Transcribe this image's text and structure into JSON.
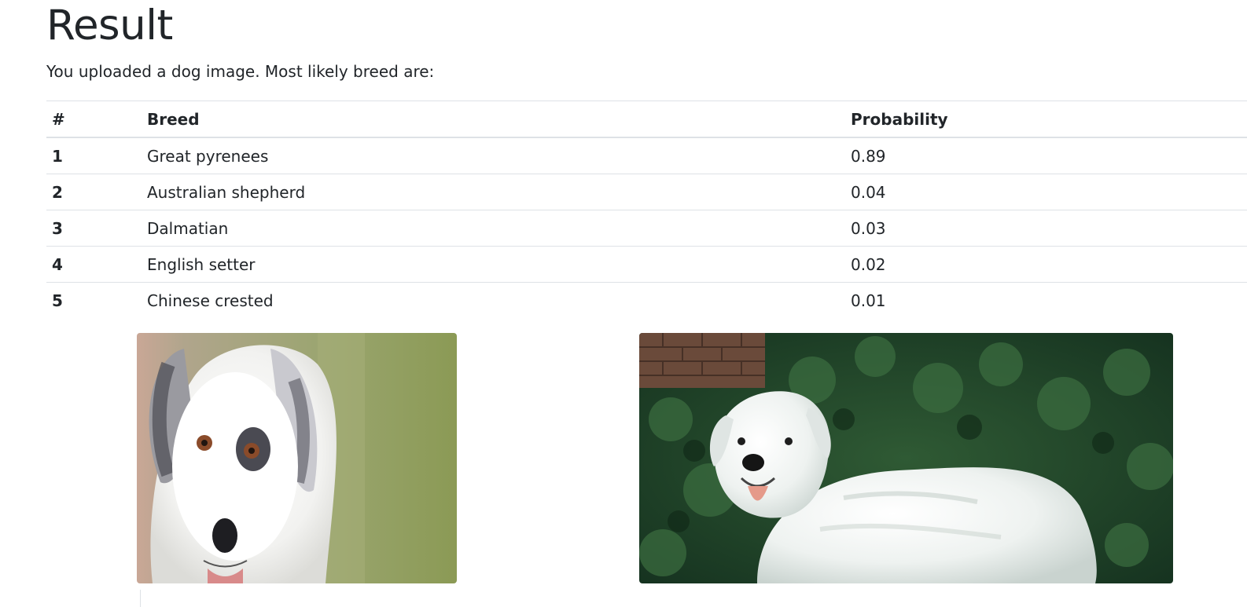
{
  "result": {
    "title": "Result",
    "subtitle": "You uploaded a dog image. Most likely breed are:"
  },
  "table": {
    "headers": [
      "#",
      "Breed",
      "Probability"
    ],
    "rows": [
      {
        "rank": "1",
        "breed": "Great pyrenees",
        "probability": "0.89"
      },
      {
        "rank": "2",
        "breed": "Australian shepherd",
        "probability": "0.04"
      },
      {
        "rank": "3",
        "breed": "Dalmatian",
        "probability": "0.03"
      },
      {
        "rank": "4",
        "breed": "English setter",
        "probability": "0.02"
      },
      {
        "rank": "5",
        "breed": "Chinese crested",
        "probability": "0.01"
      }
    ]
  },
  "images": {
    "uploaded": "uploaded-dog-photo",
    "reference": "great-pyrenees-reference-photo"
  }
}
